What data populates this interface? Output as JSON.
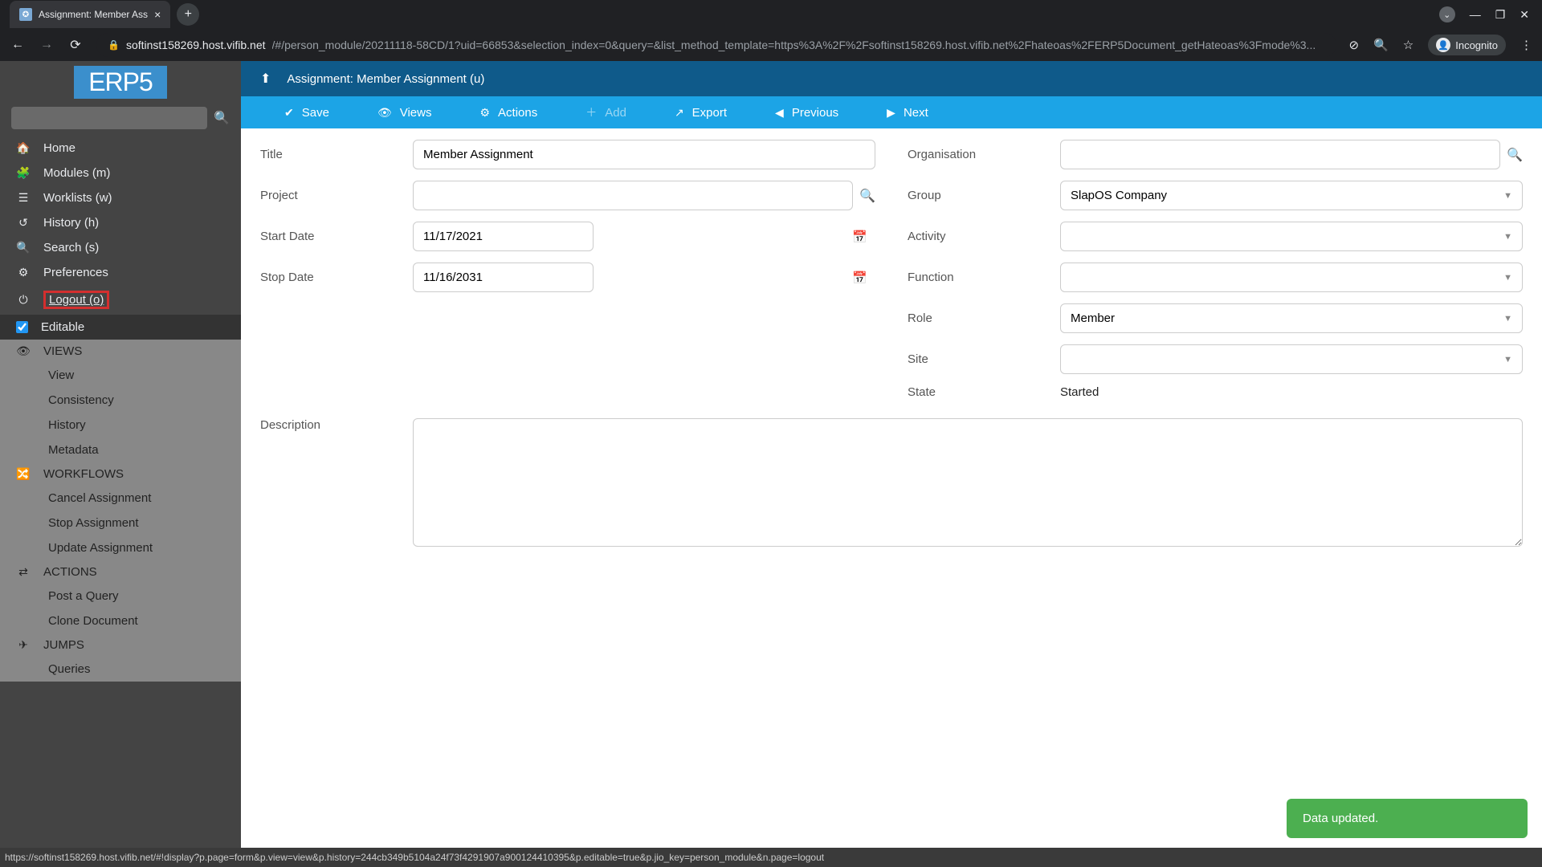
{
  "browser": {
    "tab_title": "Assignment: Member Ass",
    "url_host": "softinst158269.host.vifib.net",
    "url_path": "/#/person_module/20211118-58CD/1?uid=66853&selection_index=0&query=&list_method_template=https%3A%2F%2Fsoftinst158269.host.vifib.net%2Fhateoas%2FERP5Document_getHateoas%3Fmode%3...",
    "incognito_label": "Incognito"
  },
  "sidebar": {
    "logo": "ERP5",
    "nav": [
      {
        "icon": "home",
        "label": "Home"
      },
      {
        "icon": "puzzle",
        "label": "Modules (m)"
      },
      {
        "icon": "list",
        "label": "Worklists (w)"
      },
      {
        "icon": "history",
        "label": "History (h)"
      },
      {
        "icon": "search",
        "label": "Search (s)"
      },
      {
        "icon": "sliders",
        "label": "Preferences"
      },
      {
        "icon": "power",
        "label": "Logout (o)"
      }
    ],
    "editable_label": "Editable",
    "sections": {
      "views": {
        "header": "VIEWS",
        "items": [
          "View",
          "Consistency",
          "History",
          "Metadata"
        ]
      },
      "workflows": {
        "header": "WORKFLOWS",
        "items": [
          "Cancel Assignment",
          "Stop Assignment",
          "Update Assignment"
        ]
      },
      "actions": {
        "header": "ACTIONS",
        "items": [
          "Post a Query",
          "Clone Document"
        ]
      },
      "jumps": {
        "header": "JUMPS",
        "items": [
          "Queries"
        ]
      }
    }
  },
  "header": {
    "breadcrumb": "Assignment: Member Assignment (u)"
  },
  "toolbar": {
    "save": "Save",
    "views": "Views",
    "actions": "Actions",
    "add": "Add",
    "export": "Export",
    "previous": "Previous",
    "next": "Next"
  },
  "form": {
    "title": {
      "label": "Title",
      "value": "Member Assignment"
    },
    "project": {
      "label": "Project",
      "value": ""
    },
    "start_date": {
      "label": "Start Date",
      "value": "11/17/2021"
    },
    "stop_date": {
      "label": "Stop Date",
      "value": "11/16/2031"
    },
    "organisation": {
      "label": "Organisation",
      "value": ""
    },
    "group": {
      "label": "Group",
      "value": "SlapOS Company"
    },
    "activity": {
      "label": "Activity",
      "value": ""
    },
    "function": {
      "label": "Function",
      "value": ""
    },
    "role": {
      "label": "Role",
      "value": "Member"
    },
    "site": {
      "label": "Site",
      "value": ""
    },
    "state": {
      "label": "State",
      "value": "Started"
    },
    "description": {
      "label": "Description",
      "value": ""
    }
  },
  "toast": "Data updated.",
  "status_bar": "https://softinst158269.host.vifib.net/#!display?p.page=form&p.view=view&p.history=244cb349b5104a24f73f4291907a900124410395&p.editable=true&p.jio_key=person_module&n.page=logout"
}
